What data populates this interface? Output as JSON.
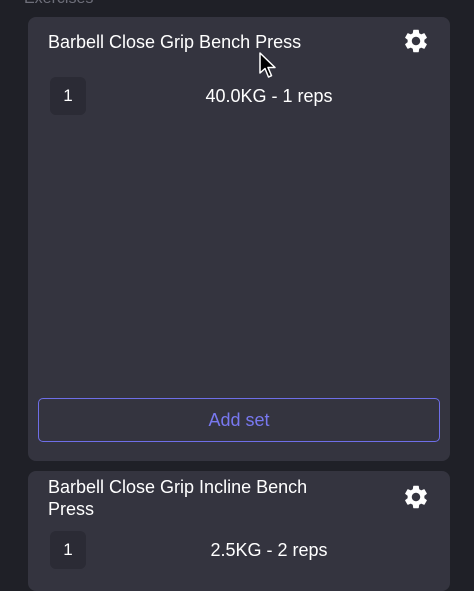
{
  "section": {
    "header": "Exercises"
  },
  "exercises": [
    {
      "name": "Barbell Close Grip Bench Press",
      "settings_icon": "gear-icon",
      "sets": [
        {
          "number": "1",
          "value": "40.0KG - 1 reps"
        }
      ],
      "add_set_label": "Add set"
    },
    {
      "name": "Barbell Close Grip Incline Bench Press",
      "settings_icon": "gear-icon",
      "sets": [
        {
          "number": "1",
          "value": "2.5KG - 2 reps"
        }
      ]
    }
  ],
  "colors": {
    "background": "#1f2027",
    "card": "#34343f",
    "accent": "#7878f0",
    "set_badge": "#2b2b35"
  }
}
